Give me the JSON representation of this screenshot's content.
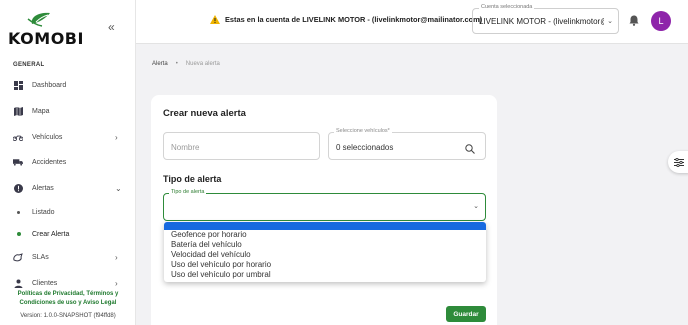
{
  "brand": {
    "name": "KOMOBI",
    "accent": "#2e8b3a"
  },
  "sidebar": {
    "section": "GENERAL",
    "items": [
      {
        "label": "Dashboard",
        "icon": "dashboard-icon"
      },
      {
        "label": "Mapa",
        "icon": "map-icon"
      },
      {
        "label": "Vehículos",
        "icon": "motorcycle-icon"
      },
      {
        "label": "Accidentes",
        "icon": "truck-crash-icon"
      },
      {
        "label": "Alertas",
        "icon": "alert-icon"
      },
      {
        "label": "SLAs",
        "icon": "sla-icon"
      },
      {
        "label": "Clientes",
        "icon": "person-icon"
      }
    ],
    "sub_items": [
      {
        "label": "Listado"
      },
      {
        "label": "Crear Alerta"
      }
    ],
    "policy": "Políticas de Privacidad, Términos y Condiciones de uso y Aviso Legal",
    "version": "Version: 1.0.0-SNAPSHOT (f94ffd8)"
  },
  "topbar": {
    "warning": "Estas en la cuenta de LIVELINK MOTOR - (livelinkmotor@mailinator.com)",
    "account_legend": "Cuenta seleccionada",
    "account_value": "LIVELINK MOTOR - (livelinkmotor@mailinator.com)",
    "avatar_letter": "L"
  },
  "breadcrumb": {
    "parent": "Alerta",
    "current": "Nueva alerta"
  },
  "form": {
    "title": "Crear nueva alerta",
    "name_placeholder": "Nombre",
    "vehicles_legend": "Seleccione vehículos*",
    "vehicles_value": "0 seleccionados",
    "type_section": "Tipo de alerta",
    "type_legend": "Tipo de alerta",
    "save": "Guardar"
  },
  "dropdown": {
    "options": [
      "Geofence por horario",
      "Batería del vehículo",
      "Velocidad del vehículo",
      "Uso del vehículo por horario",
      "Uso del vehículo por umbral"
    ]
  }
}
